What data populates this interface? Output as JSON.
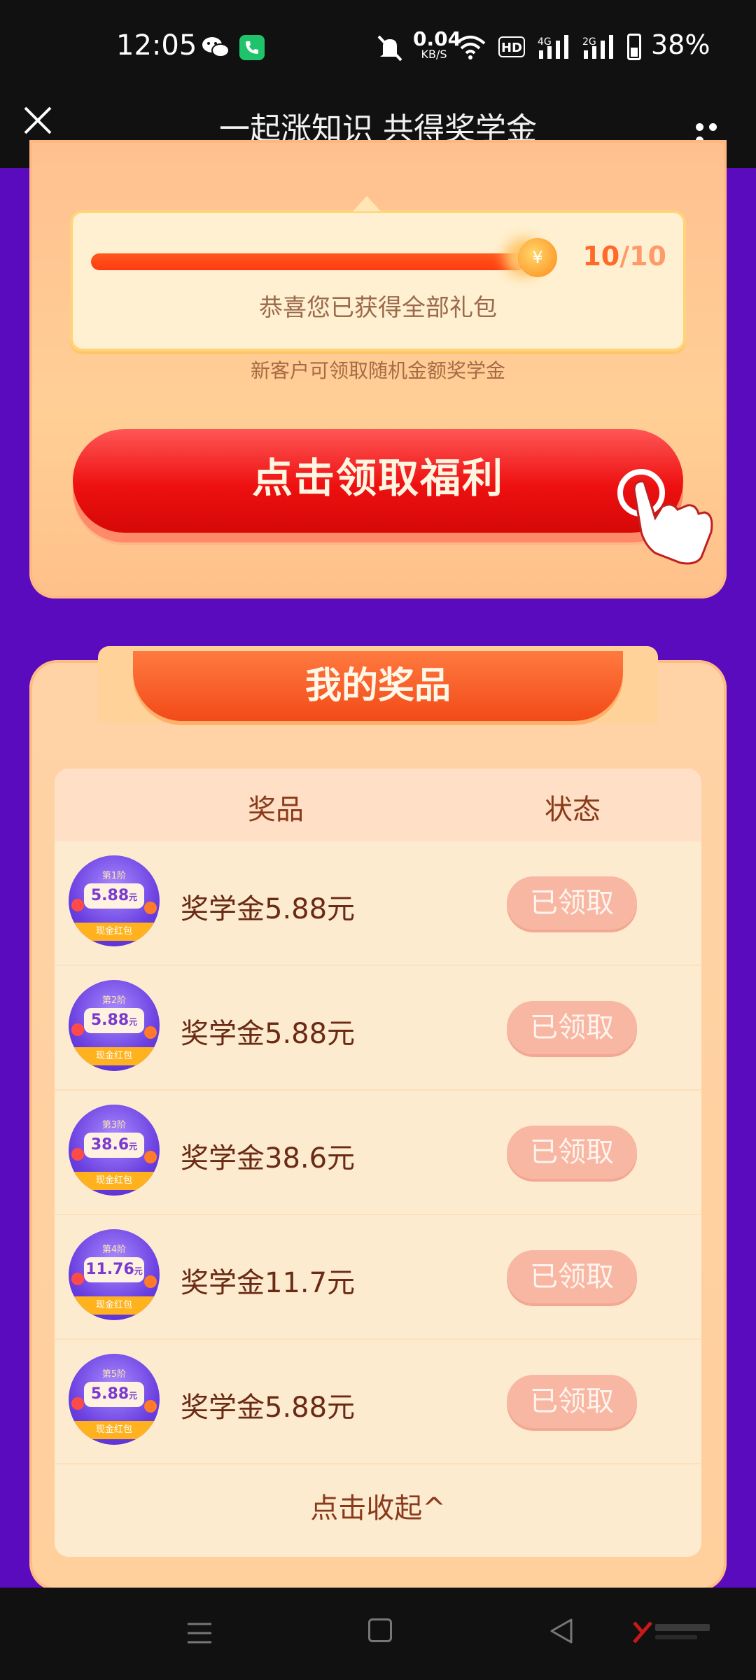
{
  "status_bar": {
    "time": "12:05",
    "net_speed_value": "0.04",
    "net_speed_unit": "KB/S",
    "hd_label": "HD",
    "signal_1_label": "4G",
    "signal_2_label": "2G",
    "battery": "38%",
    "icons": [
      "wechat-icon",
      "phone-icon",
      "mute-icon",
      "wifi-icon",
      "signal-icon",
      "battery-icon"
    ]
  },
  "title_bar": {
    "title": "一起涨知识 共得奖学金"
  },
  "progress": {
    "current": "10",
    "separator": "/",
    "total": "10",
    "fill_fraction": 1.0,
    "message": "恭喜您已获得全部礼包",
    "note": "新客户可领取随机金额奖学金"
  },
  "claim_button": {
    "label": "点击领取福利"
  },
  "prizes": {
    "header": "我的奖品",
    "col_prize": "奖品",
    "col_status": "状态",
    "rows": [
      {
        "stage": "第1阶",
        "amount": "5.88",
        "unit": "元",
        "band": "现金红包",
        "name": "奖学金5.88元",
        "status": "已领取"
      },
      {
        "stage": "第2阶",
        "amount": "5.88",
        "unit": "元",
        "band": "现金红包",
        "name": "奖学金5.88元",
        "status": "已领取"
      },
      {
        "stage": "第3阶",
        "amount": "38.6",
        "unit": "元",
        "band": "现金红包",
        "name": "奖学金38.6元",
        "status": "已领取"
      },
      {
        "stage": "第4阶",
        "amount": "11.76",
        "unit": "元",
        "band": "现金红包",
        "name": "奖学金11.7元",
        "status": "已领取"
      },
      {
        "stage": "第5阶",
        "amount": "5.88",
        "unit": "元",
        "band": "现金红包",
        "name": "奖学金5.88元",
        "status": "已领取"
      }
    ],
    "collapse": "点击收起^"
  },
  "colors": {
    "page_bg": "#5a0bbd",
    "accent_red": "#ee1010",
    "status_pill": "#f8b7a3"
  }
}
